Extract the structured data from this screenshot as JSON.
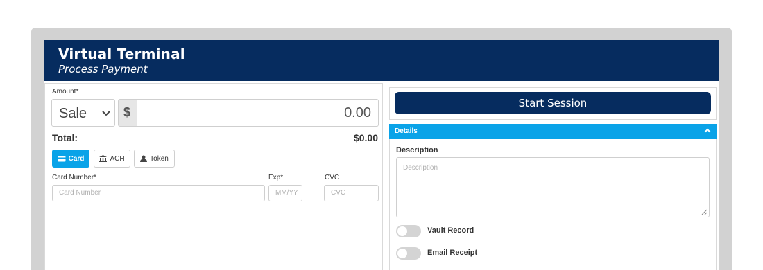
{
  "header": {
    "title": "Virtual Terminal",
    "subtitle": "Process Payment"
  },
  "payment": {
    "amount_label": "Amount",
    "required_mark": "*",
    "type_selected": "Sale",
    "currency_symbol": "$",
    "amount_value": "0.00",
    "total_label": "Total:",
    "total_value": "$0.00"
  },
  "tabs": [
    {
      "label": "Card",
      "icon": "credit-card-icon",
      "active": true
    },
    {
      "label": "ACH",
      "icon": "bank-icon",
      "active": false
    },
    {
      "label": "Token",
      "icon": "user-icon",
      "active": false
    }
  ],
  "card_form": {
    "card_number_label": "Card Number",
    "card_number_placeholder": "Card Number",
    "exp_label": "Exp",
    "exp_placeholder": "MM/YY",
    "cvc_label": "CVC",
    "cvc_placeholder": "CVC"
  },
  "session": {
    "start_label": "Start Session"
  },
  "details": {
    "title": "Details",
    "description_label": "Description",
    "description_placeholder": "Description",
    "vault_record_label": "Vault Record",
    "vault_record_on": false,
    "email_receipt_label": "Email Receipt",
    "email_receipt_on": false
  },
  "colors": {
    "header_bg": "#062c5f",
    "accent": "#0aa3e8",
    "frame": "#d2d2d2"
  }
}
